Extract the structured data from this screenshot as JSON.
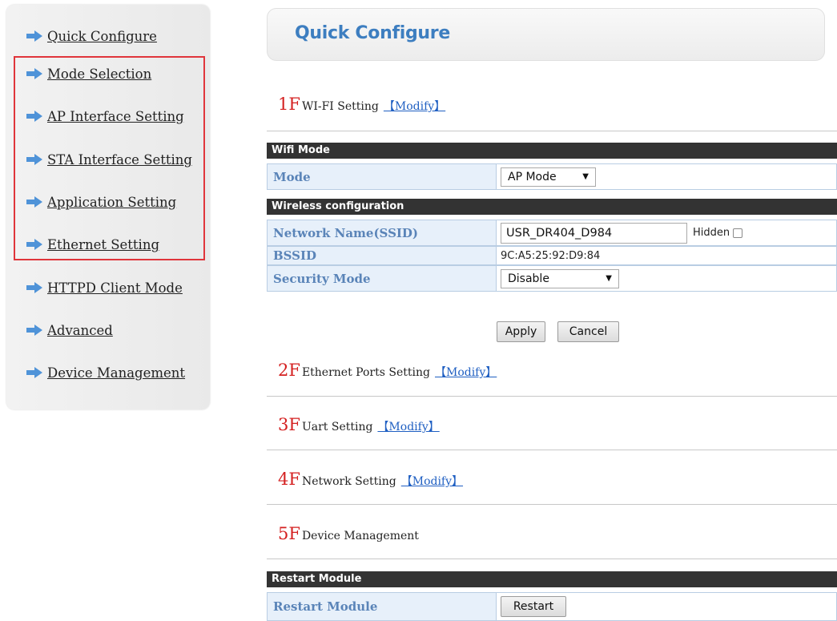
{
  "sidebar": {
    "items": [
      {
        "label": "Quick Configure"
      },
      {
        "label": "Mode Selection"
      },
      {
        "label": "AP Interface Setting"
      },
      {
        "label": "STA Interface Setting"
      },
      {
        "label": "Application Setting"
      },
      {
        "label": "Ethernet Setting"
      },
      {
        "label": "HTTPD Client Mode"
      },
      {
        "label": "Advanced"
      },
      {
        "label": "Device Management"
      }
    ]
  },
  "header": {
    "title": "Quick Configure"
  },
  "sections": [
    {
      "floor": "1F",
      "title": "WI-FI Setting",
      "modify": "【Modify】"
    },
    {
      "floor": "2F",
      "title": "Ethernet Ports Setting",
      "modify": "【Modify】"
    },
    {
      "floor": "3F",
      "title": "Uart Setting",
      "modify": "【Modify】"
    },
    {
      "floor": "4F",
      "title": "Network Setting",
      "modify": "【Modify】"
    },
    {
      "floor": "5F",
      "title": "Device Management",
      "modify": ""
    }
  ],
  "wifi": {
    "wifi_mode_header": "Wifi Mode",
    "mode_label": "Mode",
    "mode_value": "AP Mode",
    "wireless_header": "Wireless configuration",
    "ssid_label": "Network Name(SSID)",
    "ssid_value": "USR_DR404_D984",
    "hidden_label": "Hidden",
    "bssid_label": "BSSID",
    "bssid_value": "9C:A5:25:92:D9:84",
    "security_label": "Security Mode",
    "security_value": "Disable",
    "apply_label": "Apply",
    "cancel_label": "Cancel"
  },
  "device": {
    "restart_header": "Restart Module",
    "restart_label": "Restart Module",
    "restart_button": "Restart"
  },
  "colors": {
    "highlight": "#e0353b",
    "floor": "#d42020",
    "link": "#1f5fc2",
    "title": "#3d7ec0"
  }
}
